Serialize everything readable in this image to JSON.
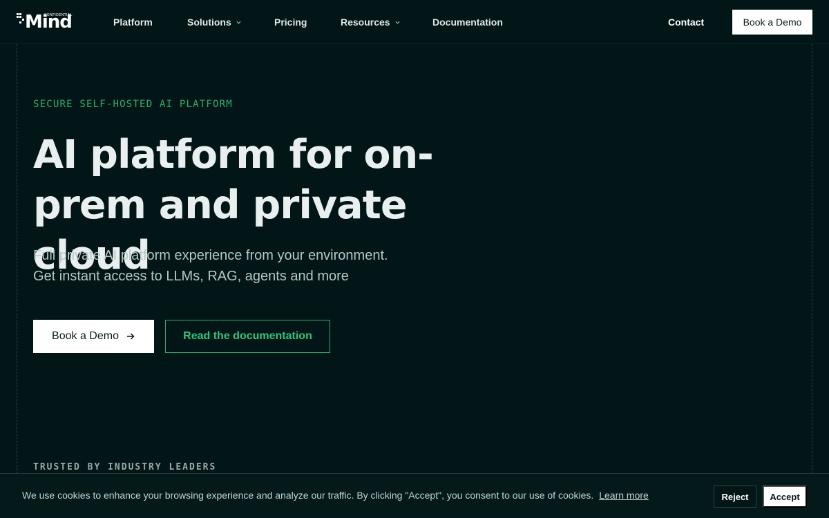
{
  "colors": {
    "background": "#021617",
    "accent_green": "#2fae6e",
    "text_primary": "#e9efef",
    "text_muted": "#b9c6c6",
    "button_bg": "#ffffff"
  },
  "brand": {
    "wordmark": "Mind",
    "tagline": "CONFIDENTIAL"
  },
  "nav": {
    "items": [
      {
        "label": "Platform",
        "has_dropdown": false
      },
      {
        "label": "Solutions",
        "has_dropdown": true
      },
      {
        "label": "Pricing",
        "has_dropdown": false
      },
      {
        "label": "Resources",
        "has_dropdown": true
      },
      {
        "label": "Documentation",
        "has_dropdown": false
      }
    ],
    "contact_label": "Contact",
    "demo_label": "Book a Demo",
    "dropdown_icon": "chevron-down-icon"
  },
  "hero": {
    "eyebrow": "SECURE SELF-HOSTED AI PLATFORM",
    "title_line1": "AI platform for on-",
    "title_line2": "prem and private cloud",
    "subtitle_line1": "Full private AI platform experience from your environment.",
    "subtitle_line2": "Get instant access to LLMs, RAG, agents and more",
    "primary_button": "Book a Demo",
    "primary_button_icon": "arrow-right-icon",
    "secondary_button": "Read the documentation"
  },
  "trusted_label": "TRUSTED BY INDUSTRY LEADERS",
  "cookie": {
    "message": "We use cookies to enhance your browsing experience and analyze our traffic. By clicking \"Accept\", you consent to our use of cookies.",
    "learn_more": "Learn more",
    "reject_label": "Reject",
    "accept_label": "Accept"
  }
}
